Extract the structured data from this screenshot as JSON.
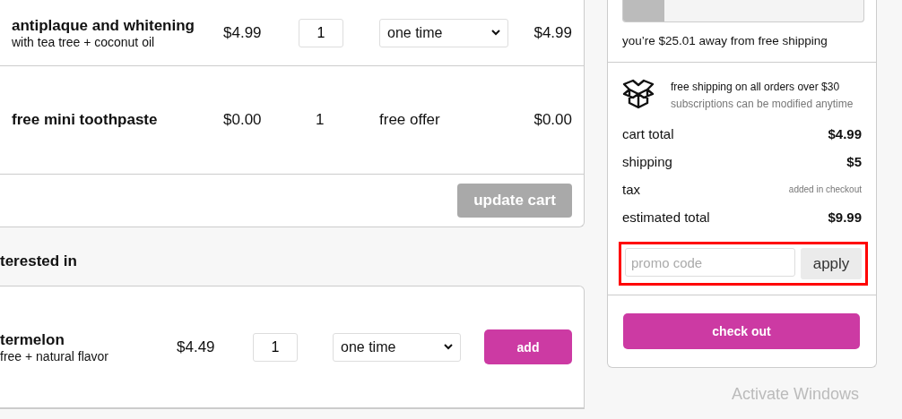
{
  "cart_items": [
    {
      "name": "antiplaque and whitening",
      "description": "with tea tree + coconut oil",
      "price": "$4.99",
      "quantity": "1",
      "frequency": "one time",
      "kind": "editable",
      "total": "$4.99"
    },
    {
      "name": "free mini toothpaste",
      "price": "$0.00",
      "quantity": "1",
      "frequency": "free offer",
      "kind": "offer",
      "total": "$0.00"
    }
  ],
  "update_cart": {
    "label": "update cart",
    "disabled": true
  },
  "suggestions": {
    "heading": "terested in",
    "items": [
      {
        "name": "termelon",
        "description": "free + natural flavor",
        "price": "$4.49",
        "quantity": "1",
        "frequency": "one time",
        "action": "add"
      }
    ]
  },
  "summary": {
    "shipping_progress": {
      "level": 0.17,
      "message": "you’re $25.01 away from free shipping"
    },
    "info": {
      "title": "free shipping on all orders over $30",
      "subtitle": "subscriptions can be modified anytime"
    },
    "lines": [
      {
        "label": "cart total",
        "value": "$4.99",
        "kind": "amount"
      },
      {
        "label": "shipping",
        "value": "$5",
        "kind": "amount"
      },
      {
        "label": "tax",
        "value": "added in checkout",
        "kind": "note"
      },
      {
        "label": "estimated total",
        "value": "$9.99",
        "kind": "amount"
      }
    ],
    "promo": {
      "placeholder": "promo code",
      "button": "apply",
      "highlighted": true
    },
    "checkout": "check out"
  },
  "os_notice": "Activate Windows"
}
